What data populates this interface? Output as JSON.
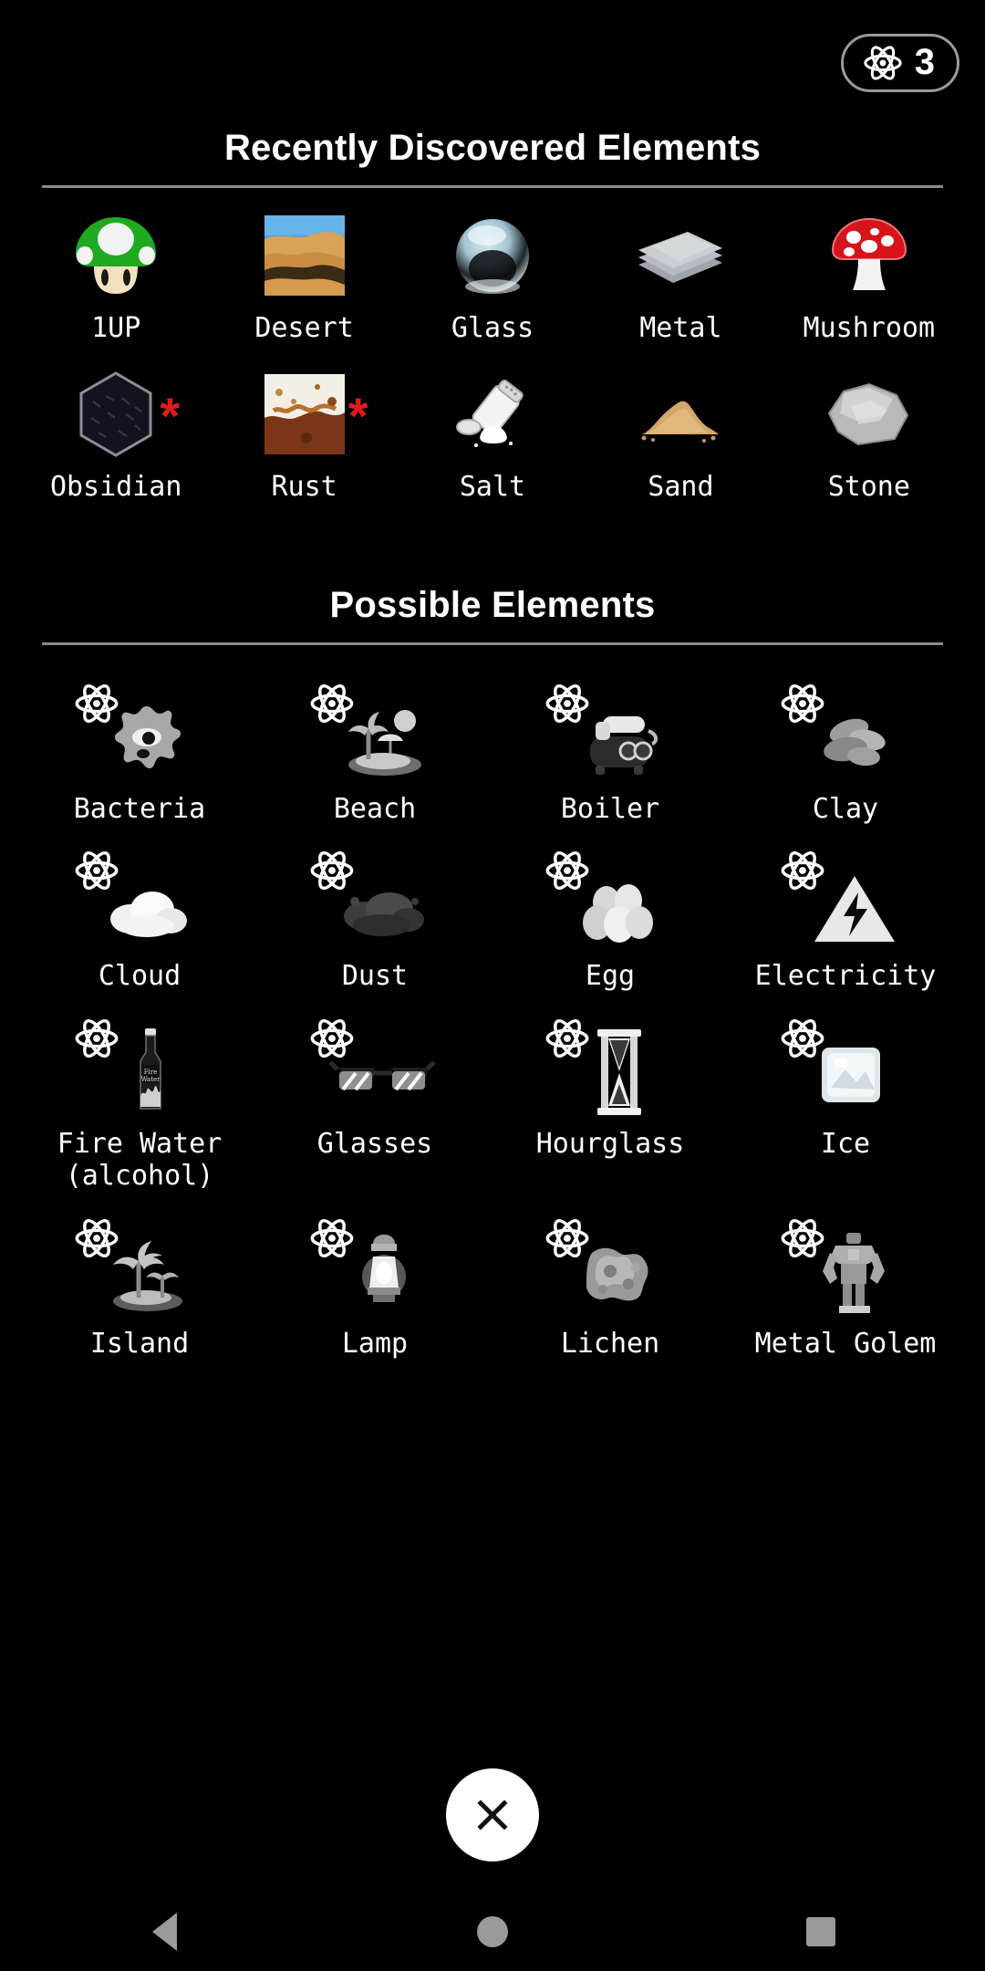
{
  "header": {
    "atom_badge": {
      "icon": "atom-icon",
      "count": "3"
    }
  },
  "recent": {
    "title": "Recently Discovered Elements",
    "items": [
      {
        "label": "1UP",
        "icon": "mushroom-1up-icon",
        "starred": false
      },
      {
        "label": "Desert",
        "icon": "desert-photo-icon",
        "starred": false
      },
      {
        "label": "Glass",
        "icon": "glass-sphere-icon",
        "starred": false
      },
      {
        "label": "Metal",
        "icon": "metal-sheets-icon",
        "starred": false
      },
      {
        "label": "Mushroom",
        "icon": "mushroom-red-icon",
        "starred": false
      },
      {
        "label": "Obsidian",
        "icon": "obsidian-cube-icon",
        "starred": true,
        "star": "*"
      },
      {
        "label": "Rust",
        "icon": "rust-texture-icon",
        "starred": true,
        "star": "*"
      },
      {
        "label": "Salt",
        "icon": "salt-shaker-icon",
        "starred": false
      },
      {
        "label": "Sand",
        "icon": "sand-pile-icon",
        "starred": false
      },
      {
        "label": "Stone",
        "icon": "stone-rock-icon",
        "starred": false
      }
    ]
  },
  "possible": {
    "title": "Possible Elements",
    "items": [
      {
        "label": "Bacteria",
        "icon": "bacteria-icon"
      },
      {
        "label": "Beach",
        "icon": "beach-icon"
      },
      {
        "label": "Boiler",
        "icon": "boiler-icon"
      },
      {
        "label": "Clay",
        "icon": "clay-icon"
      },
      {
        "label": "Cloud",
        "icon": "cloud-icon"
      },
      {
        "label": "Dust",
        "icon": "dust-icon"
      },
      {
        "label": "Egg",
        "icon": "egg-icon"
      },
      {
        "label": "Electricity",
        "icon": "electricity-icon"
      },
      {
        "label": "Fire Water\n(alcohol)",
        "icon": "fire-water-bottle-icon"
      },
      {
        "label": "Glasses",
        "icon": "glasses-icon"
      },
      {
        "label": "Hourglass",
        "icon": "hourglass-icon"
      },
      {
        "label": "Ice",
        "icon": "ice-cube-icon"
      },
      {
        "label": "Island",
        "icon": "island-icon"
      },
      {
        "label": "Lamp",
        "icon": "lamp-icon"
      },
      {
        "label": "Lichen",
        "icon": "lichen-icon"
      },
      {
        "label": "Metal Golem",
        "icon": "metal-golem-icon"
      }
    ]
  },
  "close_button": {
    "icon": "close-x-icon"
  },
  "navbar": {
    "back": "back-triangle-icon",
    "home": "home-circle-icon",
    "recents": "recents-square-icon"
  },
  "colors": {
    "background": "#000000",
    "text": "#ffffff",
    "divider": "#8a8a8a",
    "star": "#e01b1b",
    "nav": "#9a9a9a"
  }
}
